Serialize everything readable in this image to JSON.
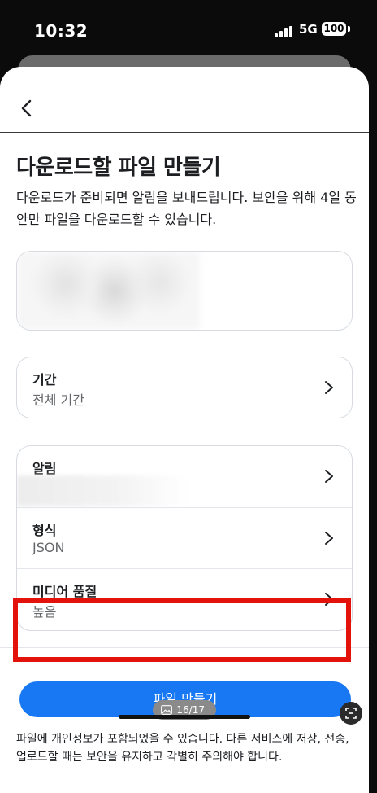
{
  "status_bar": {
    "time": "10:32",
    "network": "5G",
    "battery": "100"
  },
  "header": {
    "back_icon": "chevron-left-icon"
  },
  "page": {
    "title": "다운로드할 파일 만들기",
    "description": "다운로드가 준비되면 알림을 보내드립니다. 보안을 위해 4일 동안만 파일을 다운로드할 수 있습니다."
  },
  "period": {
    "label": "기간",
    "value": "전체 기간"
  },
  "settings": [
    {
      "label": "알림",
      "value": ""
    },
    {
      "label": "형식",
      "value": "JSON"
    },
    {
      "label": "미디어 품질",
      "value": "높음"
    }
  ],
  "footer": {
    "create_button": "파일 만들기",
    "notice": "파일에 개인정보가 포함되었을 수 있습니다. 다른 서비스에 저장, 전송, 업로드할 때는 보안을 유지하고 각별히 주의해야 합니다."
  },
  "overlay": {
    "page_indicator": "16/17",
    "accent_color": "#1877f2",
    "highlight_color": "#e3130b"
  }
}
